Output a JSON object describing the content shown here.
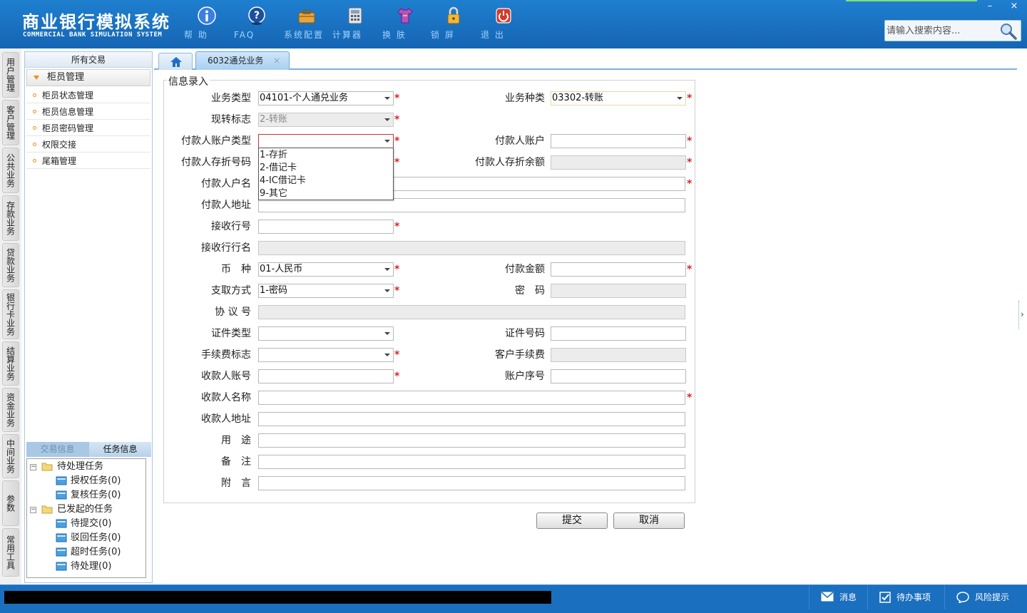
{
  "header": {
    "title_cn": "商业银行模拟系统",
    "title_en": "COMMERCIAL BANK SIMULATION SYSTEM",
    "tools": [
      "帮 助",
      "FAQ",
      "系统配置",
      "计算器",
      "换 肤",
      "锁 屏",
      "退 出"
    ],
    "minimize": "–",
    "close": "×",
    "search_placeholder": "请输入搜索内容..."
  },
  "vtabs": [
    "用户管理",
    "客户管理",
    "公共业务",
    "存款业务",
    "贷款业务",
    "银行卡业务",
    "结算业务",
    "资金业务",
    "中间业务",
    "参数",
    "常用工具"
  ],
  "left_panel": {
    "title": "所有交易",
    "group": "柜员管理",
    "items": [
      "柜员状态管理",
      "柜员信息管理",
      "柜员密码管理",
      "权限交接",
      "尾箱管理"
    ],
    "tab_trade": "交易信息",
    "tab_task": "任务信息",
    "tree": {
      "pending": "待处理任务",
      "auth": "授权任务(0)",
      "review": "复核任务(0)",
      "initiated": "已发起的任务",
      "to_submit": "待提交(0)",
      "rejected": "驳回任务(0)",
      "timeout": "超时任务(0)",
      "to_process": "待处理(0)"
    }
  },
  "tabs": {
    "work": "6032通兑业务",
    "close": "×"
  },
  "form": {
    "legend": "信息录入",
    "labels": {
      "biz_type": "业务类型",
      "biz_kind": "业务种类",
      "cash_flag": "现转标志",
      "payer_acct_type": "付款人账户类型",
      "payer_acct": "付款人账户",
      "payer_book_no": "付款人存折号码",
      "payer_book_bal": "付款人存折余额",
      "payer_name": "付款人户名",
      "payer_addr": "付款人地址",
      "recv_bank_no": "接收行号",
      "recv_bank_name": "接收行行名",
      "currency": "币　种",
      "amount": "付款金额",
      "withdraw": "支取方式",
      "password": "密　码",
      "agreement": "协 议 号",
      "id_type": "证件类型",
      "id_no": "证件号码",
      "fee_flag": "手续费标志",
      "cust_fee": "客户手续费",
      "payee_acct": "收款人账号",
      "acct_seq": "账户序号",
      "payee_name": "收款人名称",
      "payee_addr": "收款人地址",
      "purpose": "用　途",
      "remark": "备　注",
      "postscript": "附　言"
    },
    "values": {
      "biz_type": "04101-个人通兑业务",
      "biz_kind": "03302-转账",
      "cash_flag": "2-转账",
      "currency": "01-人民币",
      "withdraw": "1-密码"
    },
    "dropdown_options": [
      "1-存折",
      "2-借记卡",
      "4-IC借记卡",
      "9-其它"
    ],
    "required_mark": "*",
    "submit": "提交",
    "cancel": "取消"
  },
  "right_grip": "›",
  "statusbar": {
    "message": "消息",
    "todo": "待办事项",
    "risk": "风险提示"
  }
}
